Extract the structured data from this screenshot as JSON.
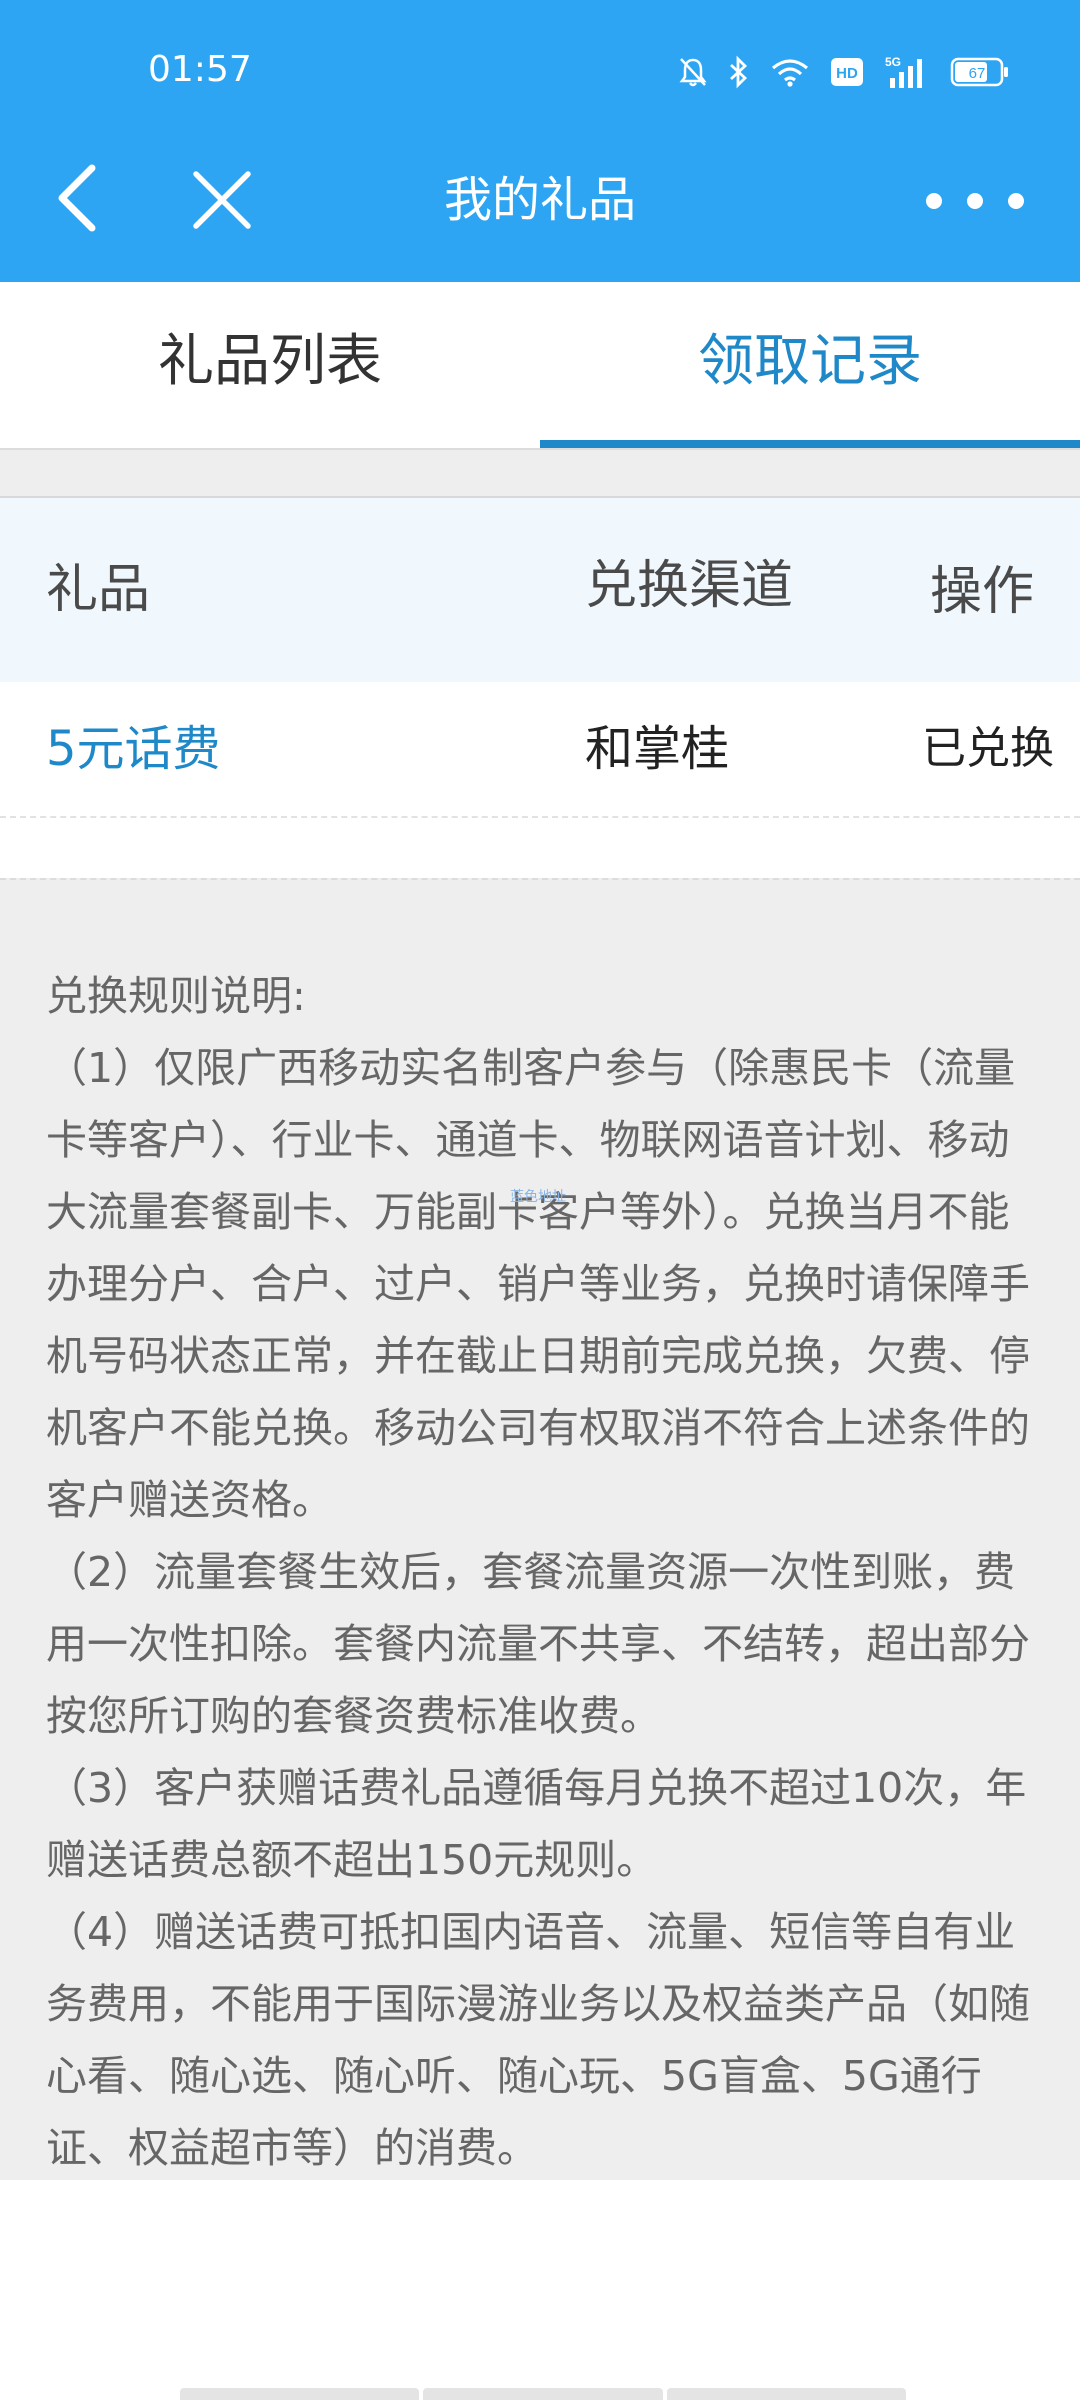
{
  "status_bar": {
    "time": "01:57",
    "battery": "67",
    "icons": [
      "mute-icon",
      "bluetooth-icon",
      "wifi-icon",
      "hd-icon",
      "5g-signal-icon",
      "battery-icon"
    ]
  },
  "nav": {
    "title": "我的礼品",
    "icons": [
      "back-icon",
      "close-icon",
      "more-icon"
    ]
  },
  "tabs": [
    {
      "label": "礼品列表",
      "active": false
    },
    {
      "label": "领取记录",
      "active": true
    }
  ],
  "table": {
    "headers": [
      "礼品",
      "兑换渠道",
      "操作"
    ],
    "rows": [
      {
        "gift": "5元话费",
        "channel": "和掌桂",
        "action": "已兑换"
      }
    ]
  },
  "rules": {
    "title": "兑换规则说明:",
    "items": [
      "（1）仅限广西移动实名制客户参与（除惠民卡（流量卡等客户）、行业卡、通道卡、物联网语音计划、移动大流量套餐副卡、万能副卡客户等外）。兑换当月不能办理分户、合户、过户、销户等业务，兑换时请保障手机号码状态正常，并在截止日期前完成兑换，欠费、停机客户不能兑换。移动公司有权取消不符合上述条件的客户赠送资格。",
      "（2）流量套餐生效后，套餐流量资源一次性到账，费用一次性扣除。套餐内流量不共享、不结转，超出部分按您所订购的套餐资费标准收费。",
      "（3）客户获赠话费礼品遵循每月兑换不超过10次，年赠送话费总额不超出150元规则。",
      "（4）赠送话费可抵扣国内语音、流量、短信等自有业务费用，不能用于国际漫游业务以及权益类产品（如随心看、随心选、随心听、随心玩、5G盲盒、5G通行证、权益超市等）的消费。"
    ],
    "watermark": "蓝色地址"
  },
  "colors": {
    "header_bg": "#2ea5f2",
    "accent": "#1e88c8",
    "rules_bg": "#eeeeee"
  }
}
